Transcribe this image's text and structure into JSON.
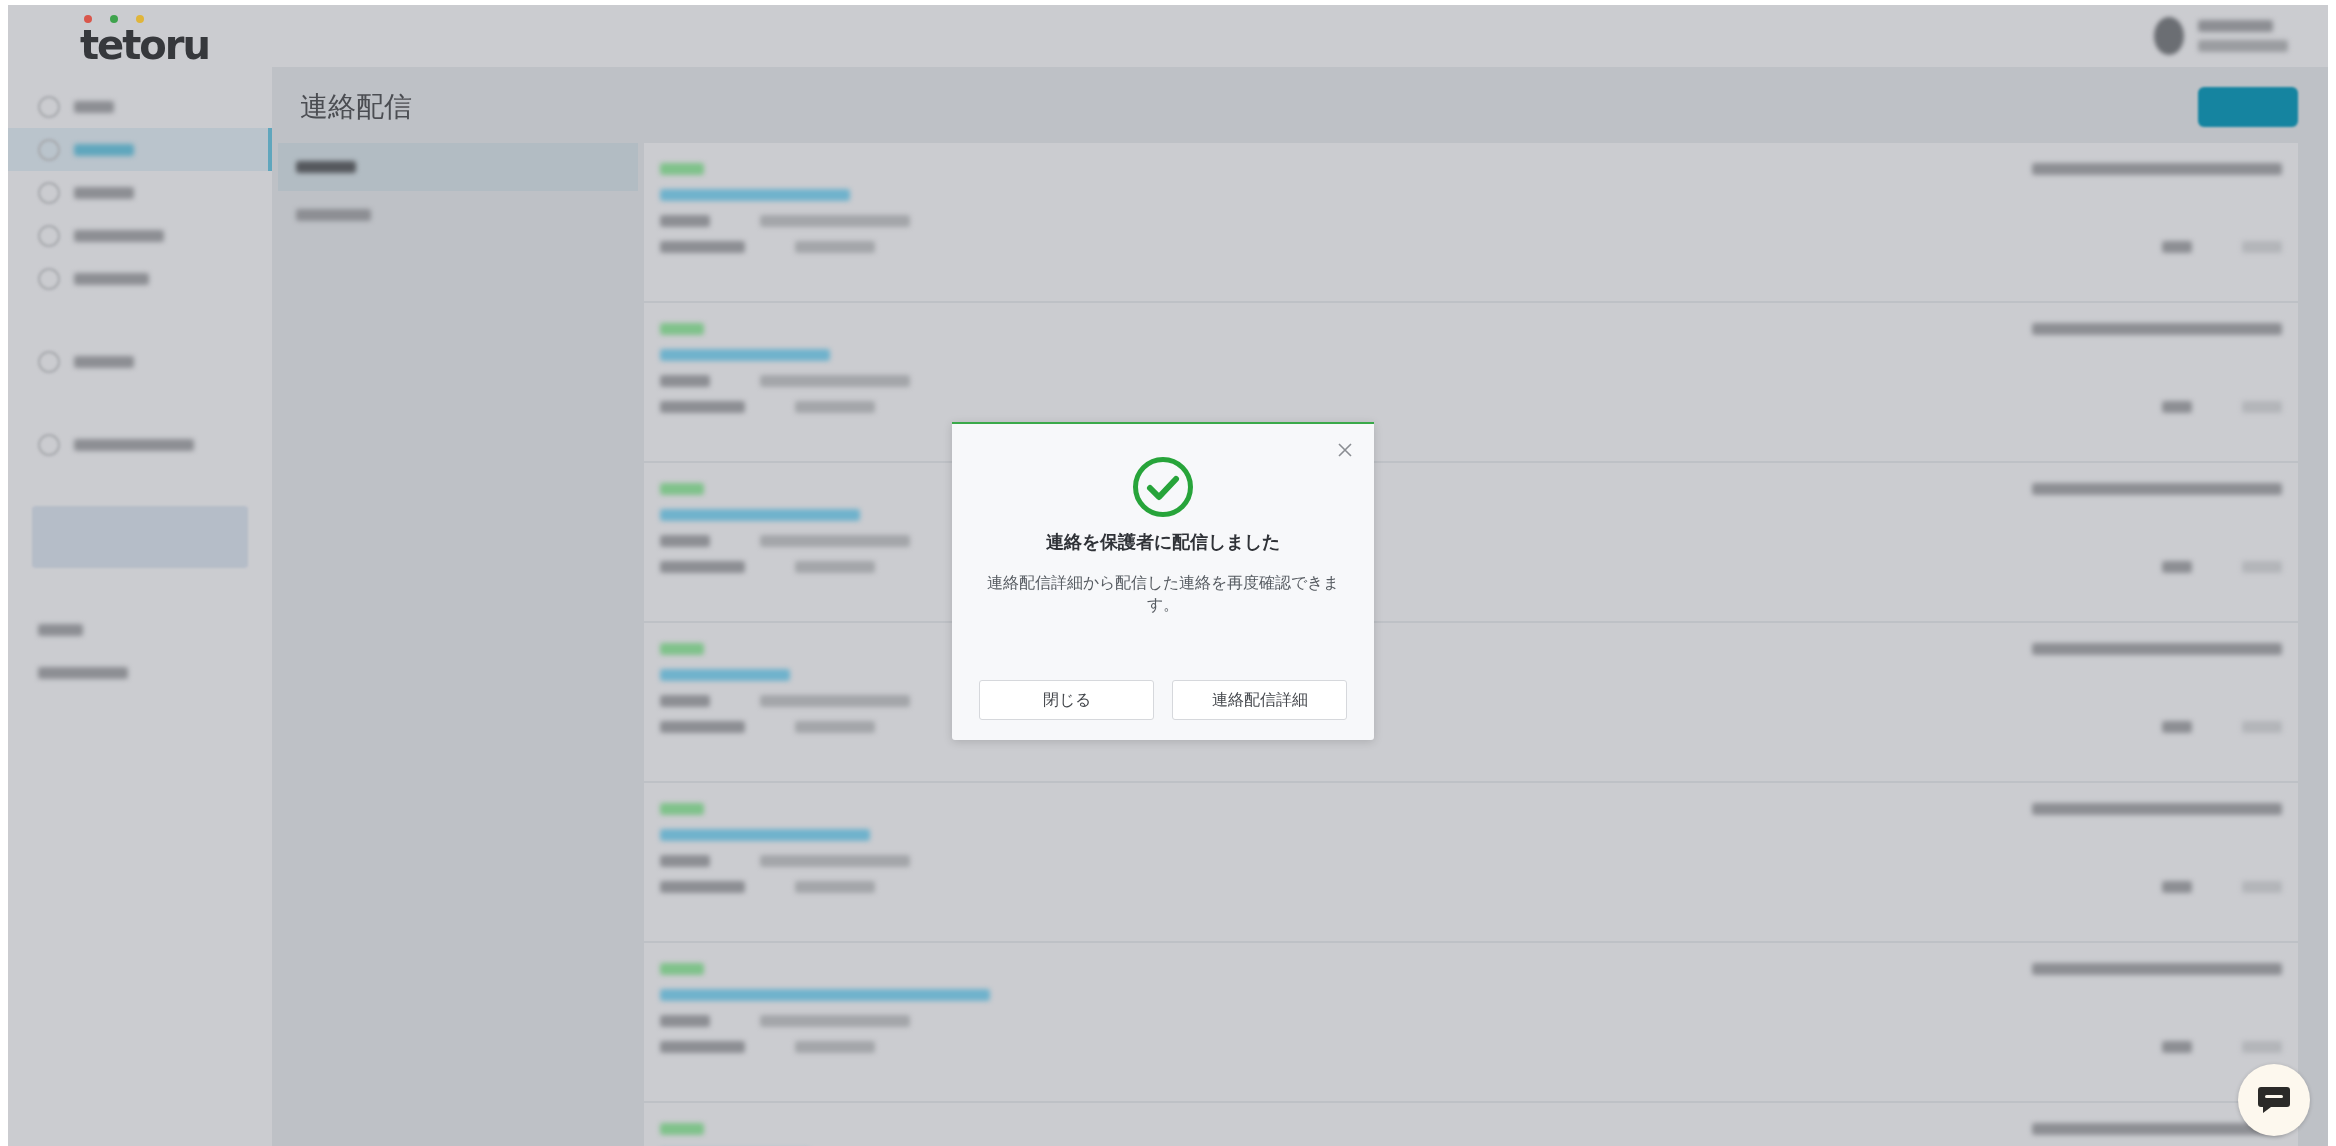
{
  "logo": {
    "text": "tetoru"
  },
  "page_title": "連絡配信",
  "dialog": {
    "title": "連絡を保護者に配信しました",
    "message": "連絡配信詳細から配信した連絡を再度確認できます。",
    "buttons": [
      "閉じる",
      "連絡配信詳細"
    ]
  }
}
